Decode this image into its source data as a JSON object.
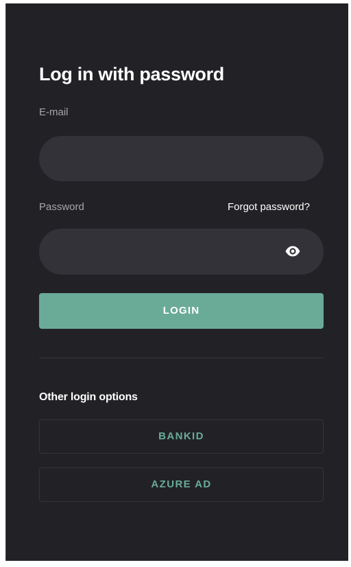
{
  "login": {
    "title": "Log in with password",
    "email_label": "E-mail",
    "email_value": "",
    "password_label": "Password",
    "password_value": "",
    "forgot_password": "Forgot password?",
    "show_password_icon": "eye-icon",
    "login_button": "LOGIN"
  },
  "other_options": {
    "title": "Other login options",
    "buttons": [
      "BANKID",
      "AZURE AD"
    ]
  },
  "colors": {
    "background": "#222226",
    "field_background": "#333238",
    "accent": "#6aab98",
    "muted_text": "#a7a7ab",
    "text": "#ffffff"
  }
}
